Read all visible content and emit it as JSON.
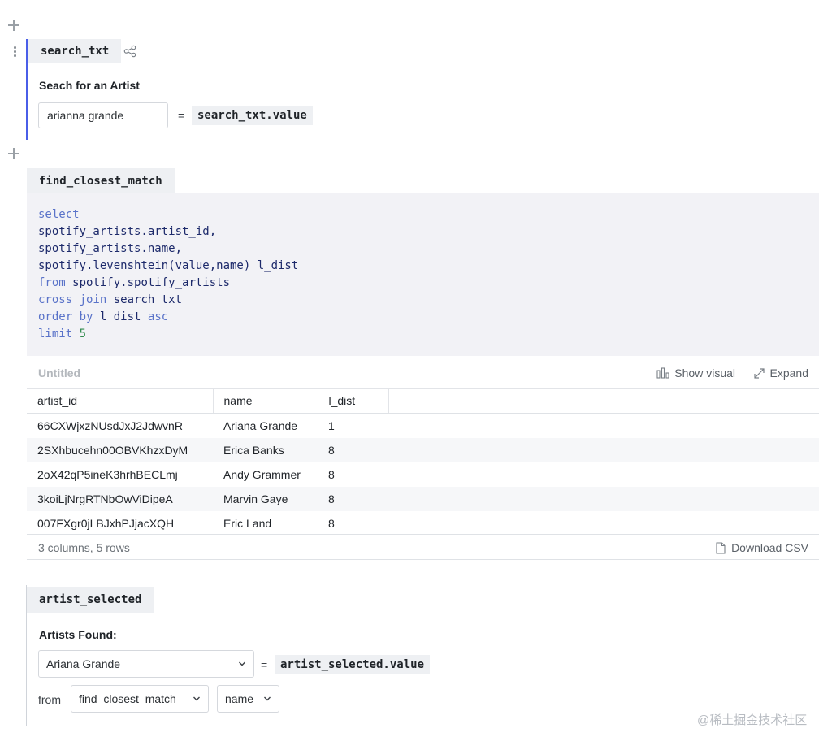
{
  "cells": {
    "search": {
      "name": "search_txt",
      "input_label": "Seach for an Artist",
      "input_value": "arianna grande",
      "equals": "=",
      "value_ref": "search_txt.value"
    },
    "sql": {
      "name": "find_closest_match",
      "code": {
        "l1": "select",
        "l2": "spotify_artists.artist_id,",
        "l3": "spotify_artists.name,",
        "l4": "spotify.levenshtein(value,name) l_dist",
        "l5_kw": "from",
        "l5_rest": "spotify.spotify_artists",
        "l6_kw": "cross join",
        "l6_rest": "search_txt",
        "l7_kw": "order by",
        "l7_id": "l_dist",
        "l7_kw2": "asc",
        "l8_kw": "limit",
        "l8_num": "5"
      },
      "results": {
        "title": "Untitled",
        "show_visual_label": "Show visual",
        "expand_label": "Expand",
        "columns": [
          "artist_id",
          "name",
          "l_dist"
        ],
        "rows": [
          [
            "66CXWjxzNUsdJxJ2JdwvnR",
            "Ariana Grande",
            "1"
          ],
          [
            "2SXhbucehn00OBVKhzxDyM",
            "Erica Banks",
            "8"
          ],
          [
            "2oX42qP5ineK3hrhBECLmj",
            "Andy Grammer",
            "8"
          ],
          [
            "3koiLjNrgRTNbOwViDipeA",
            "Marvin Gaye",
            "8"
          ],
          [
            "007FXgr0jLBJxhPJjacXQH",
            "Eric Land",
            "8"
          ]
        ],
        "summary": "3 columns, 5 rows",
        "download_label": "Download CSV"
      }
    },
    "select": {
      "name": "artist_selected",
      "label": "Artists Found:",
      "selected_value": "Ariana Grande",
      "equals": "=",
      "value_ref": "artist_selected.value",
      "from_label": "from",
      "source_value": "find_closest_match",
      "column_value": "name"
    }
  },
  "watermark": "@稀土掘金技术社区",
  "colors": {
    "accent_bar": "#4a5ee8",
    "sql_keyword": "#5a73c9",
    "sql_identifier": "#1d2a6b",
    "sql_number": "#2e8a4a",
    "code_background": "#f2f2f6"
  }
}
